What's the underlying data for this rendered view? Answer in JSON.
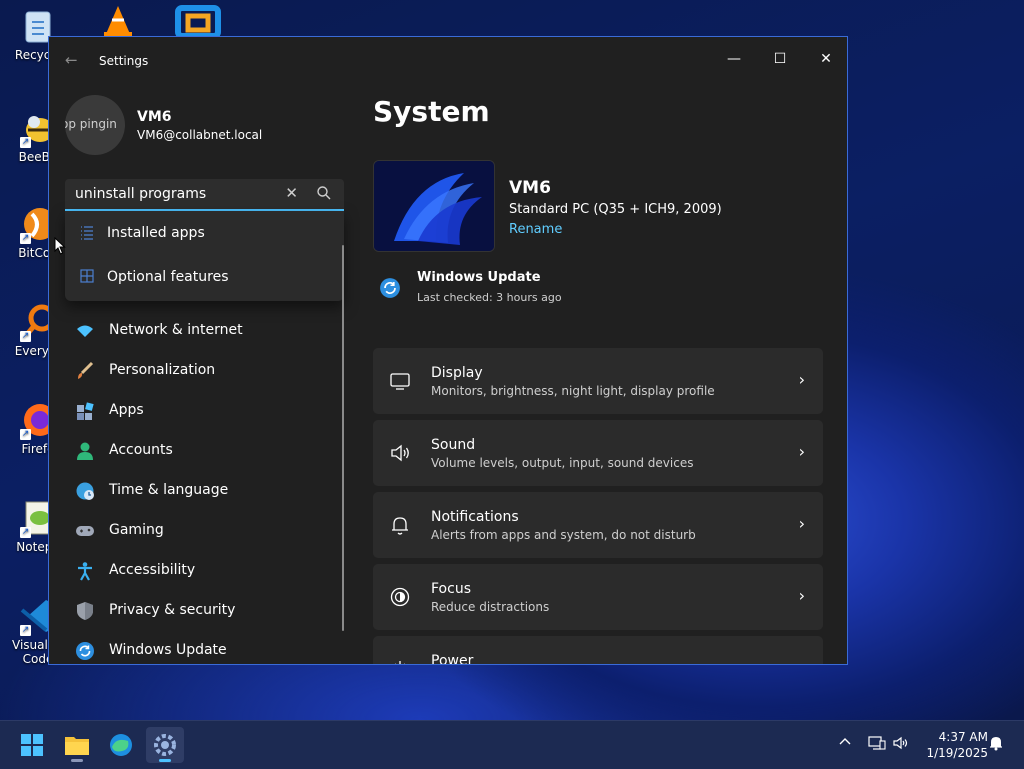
{
  "desktop": {
    "icons": [
      {
        "label": "Recycle",
        "icon": "recycle-bin-icon"
      },
      {
        "label": "BeeBE",
        "icon": "beebeep-icon"
      },
      {
        "label": "BitCon",
        "icon": "bitcomet-icon"
      },
      {
        "label": "Everyth",
        "icon": "everything-search-icon"
      },
      {
        "label": "Firefo",
        "icon": "firefox-icon"
      },
      {
        "label": "Notepa",
        "icon": "notepad-plus-plus-icon"
      },
      {
        "label": "Visual St",
        "label2": "Code",
        "icon": "vscode-icon"
      }
    ]
  },
  "window": {
    "title": "Settings",
    "back_icon": "back-arrow-icon",
    "controls": [
      "minimize",
      "maximize",
      "close"
    ]
  },
  "user": {
    "avatar_text": "op pingin",
    "name": "VM6",
    "email": "VM6@collabnet.local"
  },
  "search": {
    "value": "uninstall programs",
    "clear_icon": "clear-icon",
    "search_icon": "search-icon"
  },
  "search_results": [
    {
      "label": "Installed apps",
      "icon": "list-icon"
    },
    {
      "label": "Optional features",
      "icon": "grid-icon"
    }
  ],
  "nav": [
    {
      "label": "Network & internet",
      "icon": "wifi-icon",
      "color": "#4cc2ff"
    },
    {
      "label": "Personalization",
      "icon": "brush-icon",
      "color": "#e0a060"
    },
    {
      "label": "Apps",
      "icon": "apps-icon",
      "color": "#9ab0d0"
    },
    {
      "label": "Accounts",
      "icon": "person-icon",
      "color": "#2fb87a"
    },
    {
      "label": "Time & language",
      "icon": "globe-clock-icon",
      "color": "#3aa0e0"
    },
    {
      "label": "Gaming",
      "icon": "gamepad-icon",
      "color": "#a0a8b8"
    },
    {
      "label": "Accessibility",
      "icon": "accessibility-icon",
      "color": "#3ab0f0"
    },
    {
      "label": "Privacy & security",
      "icon": "shield-icon",
      "color": "#9aa0aa"
    },
    {
      "label": "Windows Update",
      "icon": "update-icon",
      "color": "#2d8fe0"
    }
  ],
  "page": {
    "title": "System",
    "device_name": "VM6",
    "device_model": "Standard PC (Q35 + ICH9, 2009)",
    "rename_label": "Rename",
    "update_title": "Windows Update",
    "update_sub": "Last checked: 3 hours ago"
  },
  "cards": [
    {
      "title": "Display",
      "subtitle": "Monitors, brightness, night light, display profile",
      "icon": "monitor-icon"
    },
    {
      "title": "Sound",
      "subtitle": "Volume levels, output, input, sound devices",
      "icon": "speaker-icon"
    },
    {
      "title": "Notifications",
      "subtitle": "Alerts from apps and system, do not disturb",
      "icon": "bell-icon"
    },
    {
      "title": "Focus",
      "subtitle": "Reduce distractions",
      "icon": "focus-icon"
    },
    {
      "title": "Power",
      "subtitle": "",
      "icon": "power-icon"
    }
  ],
  "taskbar": {
    "apps": [
      "start-icon",
      "file-explorer-icon",
      "edge-icon",
      "settings-icon"
    ],
    "active_app": "settings-icon",
    "tray": [
      "chevron-up-icon",
      "network-icon",
      "volume-icon",
      "notification-bell-icon"
    ],
    "time": "4:37 AM",
    "date": "1/19/2025"
  },
  "colors": {
    "accent": "#4cc2ff",
    "link": "#60cdff",
    "window_bg": "#202020",
    "card_bg": "#2b2b2b"
  }
}
